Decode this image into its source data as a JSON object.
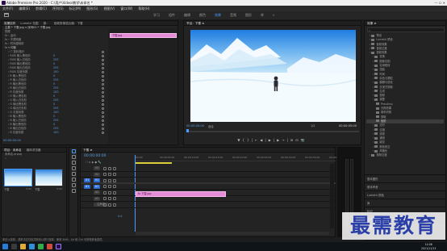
{
  "window": {
    "title": "Adobe Premiere Pro 2020 - C:\\用户\\Video\\教学\\未命名 *",
    "controls": "—  ☐  ✕"
  },
  "menu": [
    "文件(F)",
    "编辑(E)",
    "剪辑(C)",
    "序列(S)",
    "标记(M)",
    "图形(G)",
    "视图(V)",
    "窗口(W)",
    "帮助(H)"
  ],
  "workspaces": {
    "tabs": [
      "学习",
      "组件",
      "编辑",
      "颜色",
      "效果",
      "音频",
      "图形",
      "库"
    ],
    "active_index": 4,
    "more": "»"
  },
  "effect_controls": {
    "tabs": [
      "效果控件",
      "Lumetri 范围",
      "源：",
      "音频剪辑混合器：下雪"
    ],
    "source_line": "主要 * 下雪.jpg   ∨   序列01 * 下雪.jpg",
    "sections": [
      "视频",
      "运动",
      "不透明度",
      "时间重映射"
    ],
    "effect_name": "均衡",
    "params": [
      {
        "name": "☐ 鼠标指针",
        "value": ""
      },
      {
        "name": "RGB 输入黑色阶",
        "value": "0"
      },
      {
        "name": "RGB 输入白色阶",
        "value": "255"
      },
      {
        "name": "RGB 输出黑色阶",
        "value": "0"
      },
      {
        "name": "RGB 输出白色阶",
        "value": "255"
      },
      {
        "name": "RGB 灰度系数",
        "value": "100"
      },
      {
        "name": "R 输入黑色阶",
        "value": "0"
      },
      {
        "name": "R 输入白色阶",
        "value": "255"
      },
      {
        "name": "R 输出黑色阶",
        "value": "0"
      },
      {
        "name": "R 输出白色阶",
        "value": "255"
      },
      {
        "name": "R 灰度系数",
        "value": "100"
      },
      {
        "name": "G 输入黑色阶",
        "value": "0"
      },
      {
        "name": "G 输入白色阶",
        "value": "255"
      },
      {
        "name": "G 输出黑色阶",
        "value": "0"
      },
      {
        "name": "G 输出白色阶",
        "value": "255"
      },
      {
        "name": "G 灰度系数",
        "value": "100"
      },
      {
        "name": "B 输入黑色阶",
        "value": "0"
      },
      {
        "name": "B 输入白色阶",
        "value": "255"
      },
      {
        "name": "B 输出黑色阶",
        "value": "0"
      },
      {
        "name": "B 输出白色阶",
        "value": "255"
      },
      {
        "name": "B 灰度系数",
        "value": "100"
      }
    ],
    "clip_label": "下雪.jpg",
    "timecode": "00:00:00:00"
  },
  "program_monitor": {
    "title": "节目：下雪 ≡",
    "timecode_left": "00:00:00:00",
    "fit": "适合",
    "quality": "1/2",
    "timecode_right": "00:00:05:00",
    "controls": [
      "▼",
      "{",
      "}",
      "|←",
      "◀|",
      "▶",
      "|▶",
      "→|",
      "⊞",
      "⊟",
      "📷"
    ]
  },
  "project": {
    "tabs": [
      "项目：未命名",
      "媒体浏览器"
    ],
    "file": "未命名.prproj",
    "thumbnails": [
      {
        "label": "下雪",
        "duration": "5:00"
      },
      {
        "label": "下雪",
        "duration": "5:00"
      }
    ]
  },
  "timeline": {
    "title": "下雪 ≡",
    "timecode": "00:00:00:00",
    "ruler": [
      "00:00",
      "00:00:05:00",
      "00:00:10:00",
      "00:00:15:00",
      "00:00:20:00",
      "00:00:25:00",
      "00:00:30:00",
      "00:00:35:00",
      "00:00:40:00"
    ],
    "tracks": [
      {
        "label": "V3",
        "sel": false,
        "target": ""
      },
      {
        "label": "V2",
        "sel": false,
        "target": ""
      },
      {
        "label": "V1",
        "sel": true,
        "target": "V1"
      },
      {
        "label": "A1",
        "sel": true,
        "target": "A1"
      },
      {
        "label": "A2",
        "sel": false,
        "target": ""
      },
      {
        "label": "A3",
        "sel": false,
        "target": ""
      },
      {
        "label": "主声道",
        "sel": false,
        "target": ""
      }
    ],
    "clip": "fx  下雪.jpg",
    "mix_value": "0.0"
  },
  "effects_panel": {
    "title": "效果 ≡",
    "items": [
      {
        "label": "预设",
        "indent": 1,
        "sel": false
      },
      {
        "label": "Lumetri 预设",
        "indent": 1,
        "sel": false
      },
      {
        "label": "音频效果",
        "indent": 1,
        "sel": false
      },
      {
        "label": "音频过渡",
        "indent": 1,
        "sel": false
      },
      {
        "label": "视频效果",
        "indent": 1,
        "sel": false
      },
      {
        "label": "变换",
        "indent": 2,
        "sel": false
      },
      {
        "label": "图像控制",
        "indent": 2,
        "sel": false
      },
      {
        "label": "实用程序",
        "indent": 2,
        "sel": false
      },
      {
        "label": "扭曲",
        "indent": 2,
        "sel": false
      },
      {
        "label": "时间",
        "indent": 2,
        "sel": false
      },
      {
        "label": "杂色与颗粒",
        "indent": 2,
        "sel": false
      },
      {
        "label": "模糊与锐化",
        "indent": 2,
        "sel": false
      },
      {
        "label": "沉浸式视频",
        "indent": 2,
        "sel": false
      },
      {
        "label": "生成",
        "indent": 2,
        "sel": false
      },
      {
        "label": "视频",
        "indent": 2,
        "sel": false
      },
      {
        "label": "调整",
        "indent": 2,
        "sel": false
      },
      {
        "label": "ProcAmp",
        "indent": 3,
        "sel": false
      },
      {
        "label": "光照效果",
        "indent": 3,
        "sel": false
      },
      {
        "label": "卷积内核",
        "indent": 3,
        "sel": false
      },
      {
        "label": "提取",
        "indent": 3,
        "sel": false
      },
      {
        "label": "色阶",
        "indent": 3,
        "sel": true
      },
      {
        "label": "过时",
        "indent": 2,
        "sel": false
      },
      {
        "label": "过渡",
        "indent": 2,
        "sel": false
      },
      {
        "label": "透视",
        "indent": 2,
        "sel": false
      },
      {
        "label": "通道",
        "indent": 2,
        "sel": false
      },
      {
        "label": "键控",
        "indent": 2,
        "sel": false
      },
      {
        "label": "颜色校正",
        "indent": 2,
        "sel": false
      },
      {
        "label": "风格化",
        "indent": 2,
        "sel": false
      },
      {
        "label": "视频过渡",
        "indent": 1,
        "sel": false
      }
    ],
    "lower_sections": [
      "基本图形",
      "基本声音",
      "Lumetri 颜色",
      "库",
      "标记",
      "历史记录",
      "信息"
    ]
  },
  "status_text": "单击以选择，或单击空白处并拖动以进行选择。使用 Shift、Alt 和 Ctrl 可获得其他选项。",
  "clock": {
    "time": "14:06",
    "date": "2021/11/13"
  },
  "watermark": "最需教育"
}
